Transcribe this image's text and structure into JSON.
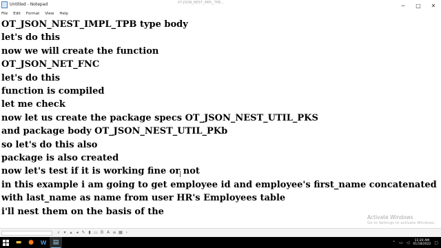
{
  "window": {
    "title": "Untitled - Notepad",
    "center_title": "07:JSON_NEST_IMPL_TPB...",
    "controls": {
      "minimize": "─",
      "maximize": "□",
      "close": "✕"
    }
  },
  "menu": [
    "File",
    "Edit",
    "Format",
    "View",
    "Help"
  ],
  "editor": {
    "lines": [
      "OT_JSON_NEST_IMPL_TPB type body",
      "let's do this",
      "now we will create the function",
      "OT_JSON_NET_FNC",
      "let's do this",
      "function is compiled",
      "let me check",
      "now let us create the package specs OT_JSON_NEST_UTIL_PKS",
      "and package body OT_JSON_NEST_UTIL_PKb",
      "so let's do this also",
      "package is also created",
      "now let's test if it is working fine or not",
      "in this example i am going to get employee id and employee's first_name concatenated",
      "with last_name as name from user HR's Employees table",
      "i'll nest them on the basis of the"
    ]
  },
  "watermark": {
    "title": "Activate Windows",
    "subtitle": "Go to Settings to activate Windows."
  },
  "toolbar_icons": [
    "find-icon",
    "down-arrow-icon",
    "up-arrow-icon",
    "nav-icon",
    "edit-icon",
    "highlight-icon",
    "comment-icon",
    "bold-icon",
    "font-icon",
    "list-icon",
    "table-icon",
    "more-icon"
  ],
  "taskbar": {
    "apps": [
      {
        "name": "file-explorer-icon",
        "glyph": "▬"
      },
      {
        "name": "firefox-icon",
        "glyph": "●"
      },
      {
        "name": "word-icon",
        "glyph": "W"
      },
      {
        "name": "notepad-icon",
        "glyph": "▤"
      }
    ],
    "time": "11:20 AM",
    "date": "01/18/2022"
  },
  "colors": {
    "taskbar_bg": "#000000",
    "accent": "#76b9ed",
    "text": "#000000",
    "watermark": "#a8a8a8"
  }
}
